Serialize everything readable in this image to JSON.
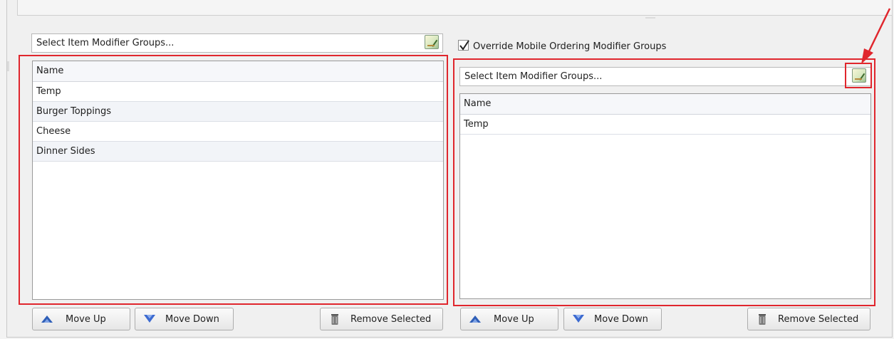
{
  "left_panel": {
    "selector_text": "Select Item Modifier Groups...",
    "grid": {
      "header": "Name",
      "rows": [
        "Temp",
        "Burger Toppings",
        "Cheese",
        "Dinner Sides"
      ]
    },
    "buttons": {
      "move_up": "Move Up",
      "move_down": "Move Down",
      "remove_selected": "Remove Selected"
    }
  },
  "right_panel": {
    "override_checkbox": {
      "label": "Override Mobile Ordering Modifier Groups",
      "checked": true
    },
    "selector_text": "Select Item Modifier Groups...",
    "grid": {
      "header": "Name",
      "rows": [
        "Temp"
      ]
    },
    "buttons": {
      "move_up": "Move Up",
      "move_down": "Move Down",
      "remove_selected": "Remove Selected"
    }
  },
  "colors": {
    "highlight_red": "#e0262d",
    "arrow_up_blue": "#2f5fb8",
    "arrow_down_blue": "#3c6ad0"
  },
  "icons": {
    "picker": "edit-list-icon",
    "move_up": "chevron-up-icon",
    "move_down": "chevron-down-icon",
    "remove": "trash-icon",
    "annotation": "red-arrow-icon"
  }
}
